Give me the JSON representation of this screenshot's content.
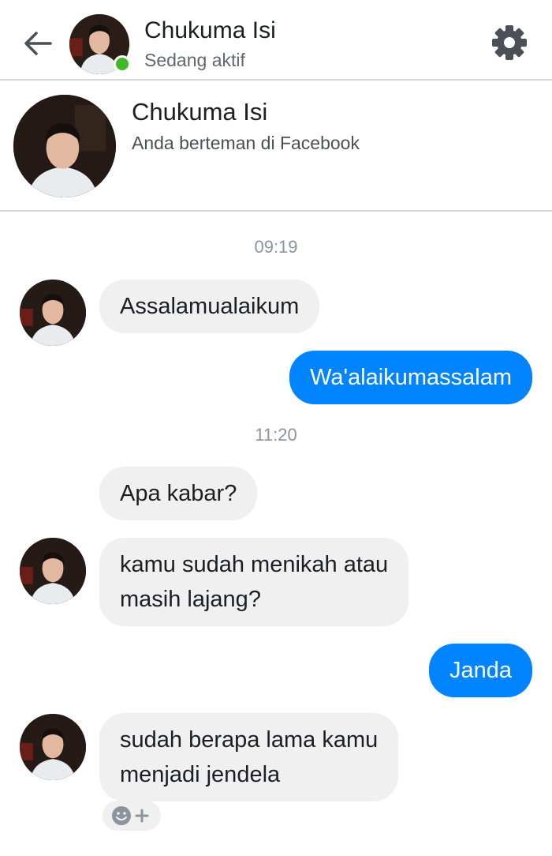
{
  "header": {
    "name": "Chukuma Isi",
    "status": "Sedang aktif",
    "icons": {
      "back": "back-arrow-icon",
      "settings": "gear-icon"
    }
  },
  "profile": {
    "name": "Chukuma Isi",
    "subtitle": "Anda berteman di Facebook"
  },
  "timestamps": [
    "09:19",
    "11:20"
  ],
  "messages": [
    {
      "side": "in",
      "text": "Assalamualaikum"
    },
    {
      "side": "out",
      "text": "Wa'alaikumassalam"
    },
    {
      "side": "in",
      "text": "Apa kabar?"
    },
    {
      "side": "in",
      "text": "kamu sudah menikah atau\nmasih lajang?"
    },
    {
      "side": "out",
      "text": "Janda"
    },
    {
      "side": "in",
      "text": "sudah berapa lama kamu\nmenjadi jendela"
    }
  ],
  "reaction": {
    "icons": [
      "smiley-icon",
      "plus-icon"
    ]
  },
  "colors": {
    "outgoing_bubble": "#0084ff",
    "incoming_bubble": "#f1f0f0",
    "online": "#42b72a",
    "divider": "#d8dadd"
  }
}
